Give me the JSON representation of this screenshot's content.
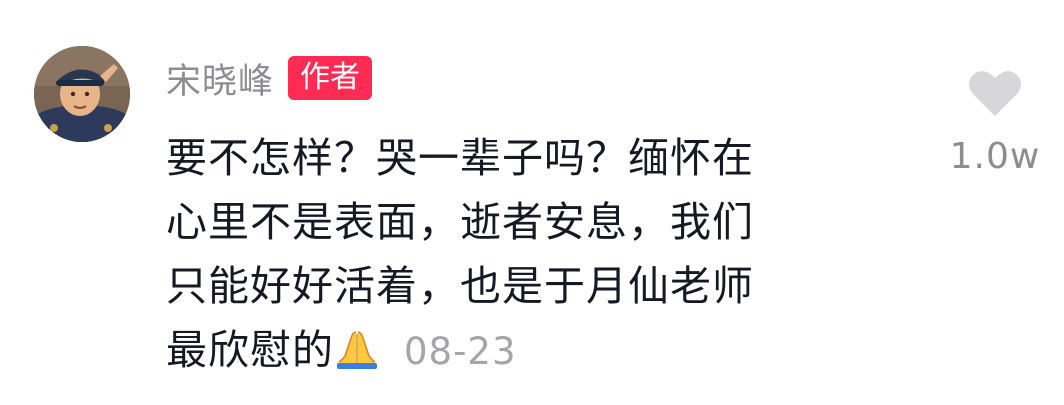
{
  "comment": {
    "username": "宋晓峰",
    "author_badge": "作者",
    "text_lines": [
      "要不怎样？哭一辈子吗？缅怀在",
      "心里不是表面，逝者安息，我们",
      "只能好好活着，也是于月仙老师",
      "最欣慰的"
    ],
    "emoji": "folded-hands-icon",
    "timestamp": "08-23",
    "like_count": "1.0w",
    "like_icon": "heart-icon"
  },
  "colors": {
    "badge": "#fe2c55",
    "username": "#8d8d8f",
    "text": "#161823",
    "timestamp": "#a5a5a8",
    "heart": "#d7d7d9"
  }
}
